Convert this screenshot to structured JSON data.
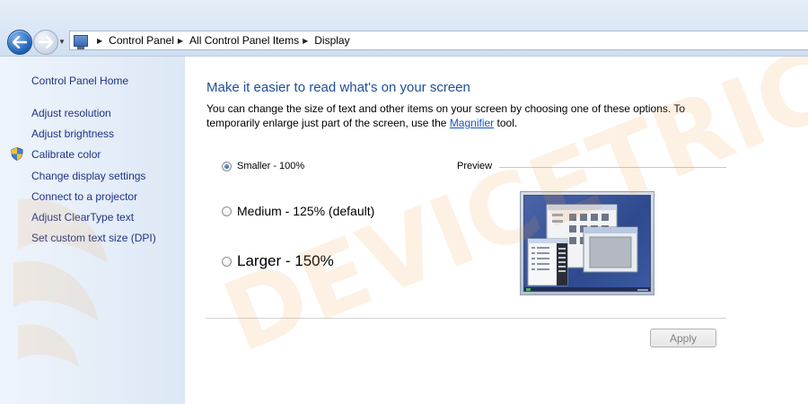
{
  "breadcrumb": {
    "items": [
      "Control Panel",
      "All Control Panel Items",
      "Display"
    ]
  },
  "sidebar": {
    "home": "Control Panel Home",
    "items": [
      {
        "label": "Adjust resolution"
      },
      {
        "label": "Adjust brightness"
      },
      {
        "label": "Calibrate color",
        "icon": "shield-icon"
      },
      {
        "label": "Change display settings"
      },
      {
        "label": "Connect to a projector"
      },
      {
        "label": "Adjust ClearType text"
      },
      {
        "label": "Set custom text size (DPI)"
      }
    ]
  },
  "main": {
    "title": "Make it easier to read what's on your screen",
    "description_before": "You can change the size of text and other items on your screen by choosing one of these options. To temporarily enlarge just part of the screen, use the ",
    "description_link": "Magnifier",
    "description_after": " tool.",
    "options": [
      {
        "label": "Smaller - 100%",
        "selected": true
      },
      {
        "label": "Medium - 125% (default)",
        "selected": false
      },
      {
        "label": "Larger - 150%",
        "selected": false
      }
    ],
    "preview_label": "Preview",
    "apply_label": "Apply"
  },
  "watermark": {
    "text": "DEVICETRICKS",
    "color": "#f5a24a"
  },
  "colors": {
    "link": "#1e3287",
    "title": "#1e4e9a",
    "hyperlink": "#0b57c9"
  }
}
